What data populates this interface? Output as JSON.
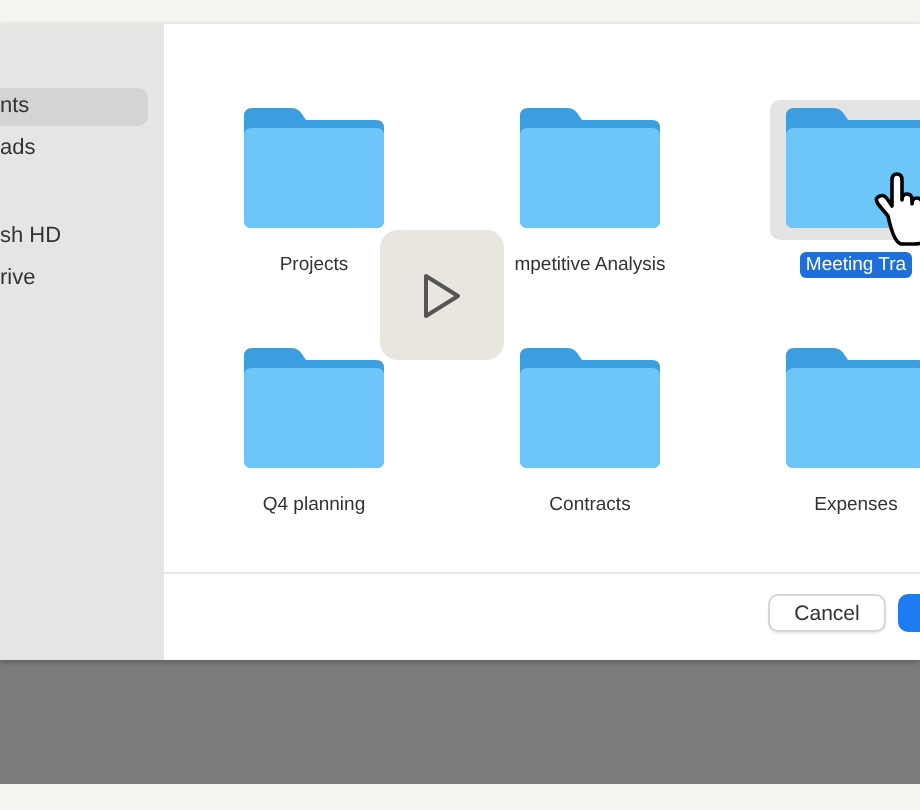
{
  "sidebar": {
    "sections": [
      {
        "items": [
          {
            "label": "nts",
            "selected": true
          },
          {
            "label": "ads",
            "selected": false
          }
        ]
      },
      {
        "items": [
          {
            "label": "sh HD",
            "selected": false
          },
          {
            "label": "rive",
            "selected": false
          }
        ]
      }
    ]
  },
  "folders": [
    {
      "name": "Projects",
      "selected": false
    },
    {
      "name": "mpetitive Analysis",
      "selected": false
    },
    {
      "name": "Meeting Tra",
      "selected": true
    },
    {
      "name": "Q4 planning",
      "selected": false
    },
    {
      "name": "Contracts",
      "selected": false
    },
    {
      "name": "Expenses",
      "selected": false
    }
  ],
  "buttons": [
    {
      "label": "Cancel",
      "kind": "secondary"
    },
    {
      "kind": "primary"
    }
  ]
}
